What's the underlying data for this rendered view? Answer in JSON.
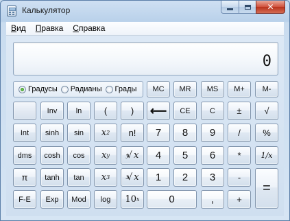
{
  "window": {
    "title": "Калькулятор",
    "icon": "calculator-icon",
    "controls": {
      "minimize": "minimize-icon",
      "maximize": "maximize-icon",
      "close": "✕"
    }
  },
  "menu": [
    {
      "label": "Вид",
      "accel": "В",
      "rest": "ид"
    },
    {
      "label": "Правка",
      "accel": "П",
      "rest": "равка"
    },
    {
      "label": "Справка",
      "accel": "С",
      "rest": "правка"
    }
  ],
  "display": {
    "value": "0"
  },
  "angle_units": {
    "selected": "Градусы",
    "options": [
      "Градусы",
      "Радианы",
      "Грады"
    ]
  },
  "memory": {
    "mc": "MC",
    "mr": "MR",
    "ms": "MS",
    "mplus": "M+",
    "mminus": "M-"
  },
  "row1": {
    "blank": "",
    "inv": "Inv",
    "ln": "ln",
    "lparen": "(",
    "rparen": ")",
    "backspace": "⟵",
    "ce": "CE",
    "c": "C",
    "plusminus": "±",
    "sqrt": "√"
  },
  "row2": {
    "int": "Int",
    "sinh": "sinh",
    "sin": "sin",
    "x2_base": "x",
    "x2_exp": "2",
    "fact": "n!",
    "d7": "7",
    "d8": "8",
    "d9": "9",
    "div": "/",
    "pct": "%"
  },
  "row3": {
    "dms": "dms",
    "cosh": "cosh",
    "cos": "cos",
    "xy_base": "x",
    "xy_exp": "y",
    "yroot_pre": "y",
    "yroot_mid": "√",
    "yroot_x": "x",
    "d4": "4",
    "d5": "5",
    "d6": "6",
    "mul": "*",
    "recip": "1/x"
  },
  "row4": {
    "pi": "π",
    "tanh": "tanh",
    "tan": "tan",
    "x3_base": "x",
    "x3_exp": "3",
    "cbrt_pre": "3",
    "cbrt_mid": "√",
    "cbrt_x": "x",
    "d1": "1",
    "d2": "2",
    "d3": "3",
    "sub": "-",
    "eq": "="
  },
  "row5": {
    "fe": "F-E",
    "exp": "Exp",
    "mod": "Mod",
    "log": "log",
    "tenx_base": "10",
    "tenx_exp": "x",
    "d0": "0",
    "dot": ",",
    "add": "+"
  }
}
